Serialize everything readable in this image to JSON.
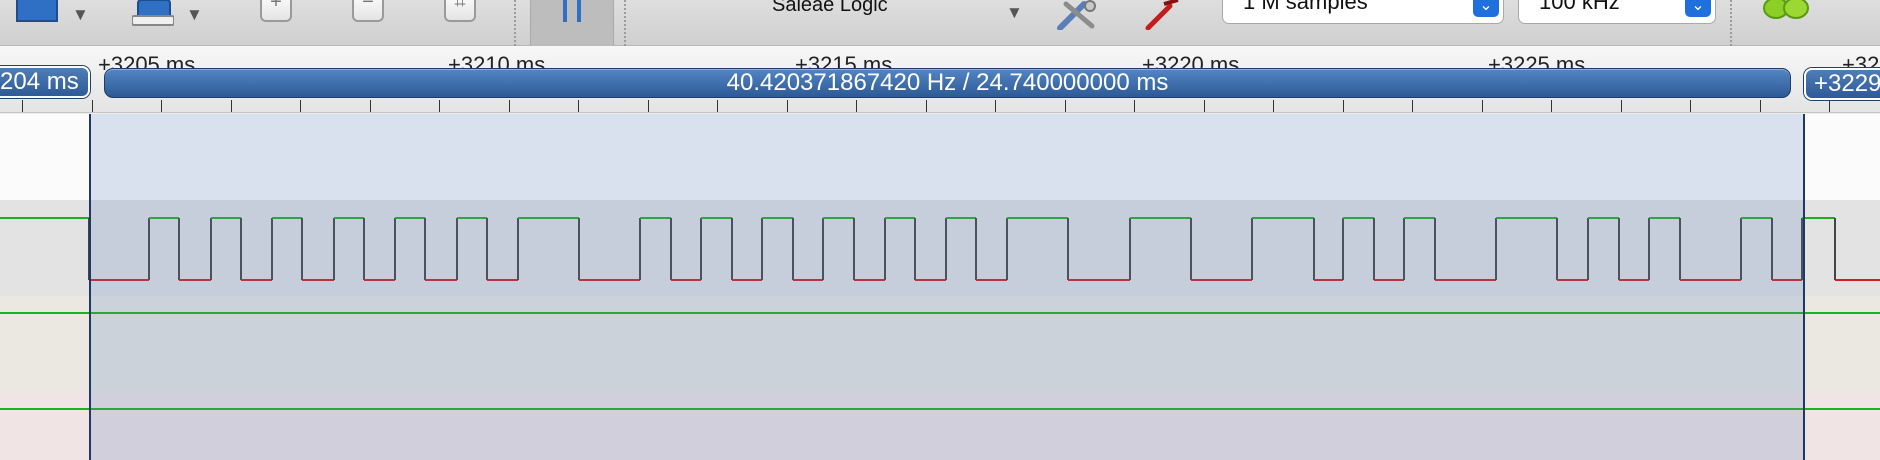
{
  "toolbar": {
    "device_name": "Saleae Logic",
    "samples_value": "1 M samples",
    "rate_value": "100 kHz"
  },
  "ruler": {
    "left_cursor_label": "204 ms",
    "right_cursor_label": "+3229",
    "far_right_label": "+32",
    "tick_labels": [
      "+3205 ms",
      "+3210 ms",
      "+3215 ms",
      "+3220 ms",
      "+3225 ms"
    ],
    "measurement": "40.420371867420 Hz / 24.740000000 ms"
  },
  "colors": {
    "selection": "#5a82b9",
    "marker": "#2e5b97",
    "signal_high": "#1db11d",
    "signal_low": "#d41d1d",
    "channel_line": "#1db11d"
  },
  "channels": [
    {
      "id": "ch0",
      "signal": "pulse-train"
    },
    {
      "id": "ch1",
      "signal": "flat-high"
    },
    {
      "id": "ch2",
      "signal": "flat-high"
    }
  ]
}
